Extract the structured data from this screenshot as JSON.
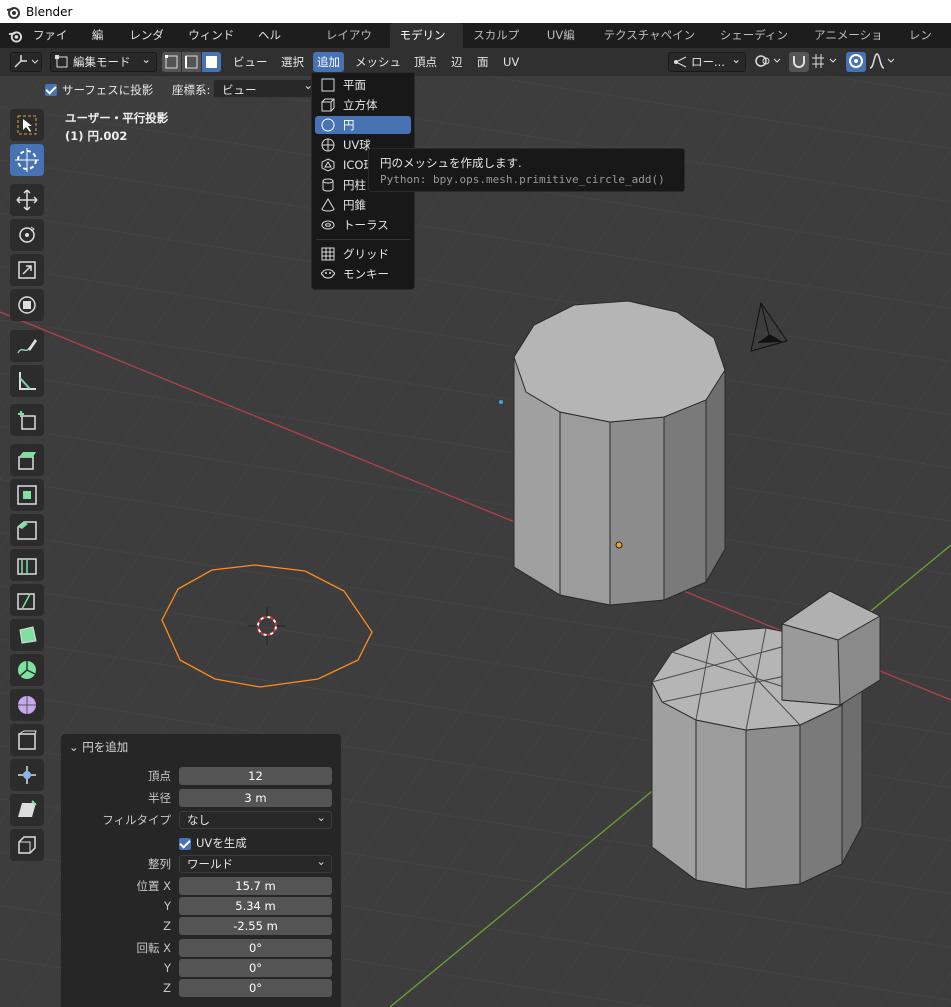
{
  "window": {
    "title": "Blender"
  },
  "menubar": {
    "items": [
      "ファイル",
      "編集",
      "レンダー",
      "ウィンドウ",
      "ヘルプ"
    ],
    "workspaces": [
      "レイアウト",
      "モデリング",
      "スカルプト",
      "UV編集",
      "テクスチャペイント",
      "シェーディング",
      "アニメーション",
      "レンダ"
    ],
    "active_workspace": "モデリング"
  },
  "header": {
    "mode": "編集モード",
    "menus": [
      "ビュー",
      "選択",
      "追加",
      "メッシュ",
      "頂点",
      "辺",
      "面",
      "UV"
    ],
    "open_menu": "追加",
    "pivot_label": "ロー..."
  },
  "subheader": {
    "project_label": "サーフェスに投影",
    "project_checked": true,
    "coord_label": "座標系:",
    "coord_value": "ビュー"
  },
  "viewport": {
    "view_name": "ユーザー・平行投影",
    "object_name": "(1) 円.002"
  },
  "add_menu": {
    "items": [
      {
        "label": "平面",
        "icon": "plane-icon"
      },
      {
        "label": "立方体",
        "icon": "cube-icon"
      },
      {
        "label": "円",
        "icon": "circle-icon",
        "highlighted": true
      },
      {
        "label": "UV球",
        "icon": "uv-sphere-icon"
      },
      {
        "label": "ICO球",
        "icon": "ico-sphere-icon"
      },
      {
        "label": "円柱",
        "icon": "cylinder-icon"
      },
      {
        "label": "円錐",
        "icon": "cone-icon"
      },
      {
        "label": "トーラス",
        "icon": "torus-icon"
      },
      {
        "label": "グリッド",
        "icon": "grid-icon"
      },
      {
        "label": "モンキー",
        "icon": "monkey-icon"
      }
    ]
  },
  "tooltip": {
    "description": "円のメッシュを作成します.",
    "python": "Python: bpy.ops.mesh.primitive_circle_add()"
  },
  "operator_panel": {
    "title": "円を追加",
    "vertices_label": "頂点",
    "vertices": "12",
    "radius_label": "半径",
    "radius": "3 m",
    "fill_label": "フィルタイプ",
    "fill": "なし",
    "uv_label": "UVを生成",
    "uv_checked": true,
    "align_label": "整列",
    "align": "ワールド",
    "loc_x_label": "位置 X",
    "loc_x": "15.7 m",
    "loc_y_label": "Y",
    "loc_y": "5.34 m",
    "loc_z_label": "Z",
    "loc_z": "-2.55 m",
    "rot_x_label": "回転 X",
    "rot_x": "0°",
    "rot_y_label": "Y",
    "rot_y": "0°",
    "rot_z_label": "Z",
    "rot_z": "0°"
  },
  "colors": {
    "accent": "#4772b3",
    "x_axis": "#b3404a",
    "y_axis": "#6ea034",
    "selection": "#ff8c1a"
  }
}
